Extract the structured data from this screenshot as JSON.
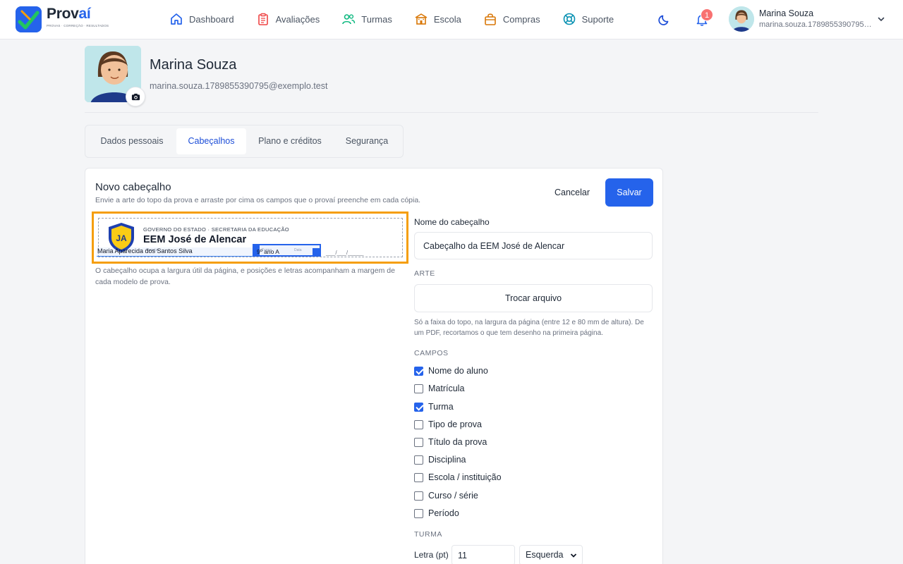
{
  "brand": {
    "name_main": "Prov",
    "name_accent": "aí",
    "tagline": "PROVAS · CORREÇÃO · RESULTADOS",
    "accent_color": "#2563eb"
  },
  "nav": [
    {
      "label": "Dashboard",
      "icon": "home-icon",
      "color": "#2563eb"
    },
    {
      "label": "Avaliações",
      "icon": "clipboard-icon",
      "color": "#ef4444"
    },
    {
      "label": "Turmas",
      "icon": "users-icon",
      "color": "#10b981"
    },
    {
      "label": "Escola",
      "icon": "school-icon",
      "color": "#d97706"
    },
    {
      "label": "Compras",
      "icon": "shopping-bag-icon",
      "color": "#d97706"
    },
    {
      "label": "Suporte",
      "icon": "lifebuoy-icon",
      "color": "#0891b2"
    }
  ],
  "notifications": {
    "count": "1"
  },
  "user": {
    "name": "Marina Souza",
    "email": "marina.souza.1789855390795@exemplo.test"
  },
  "profile": {
    "name": "Marina Souza",
    "email": "marina.souza.1789855390795@exemplo.test"
  },
  "tabs": [
    {
      "label": "Dados pessoais",
      "active": false
    },
    {
      "label": "Cabeçalhos",
      "active": true
    },
    {
      "label": "Plano e créditos",
      "active": false
    },
    {
      "label": "Segurança",
      "active": false
    }
  ],
  "editor": {
    "title": "Novo cabeçalho",
    "subtitle": "Envie a arte do topo da prova e arraste por cima os campos que o provaí preenche em cada cópia.",
    "cancel_label": "Cancelar",
    "save_label": "Salvar",
    "preview": {
      "shield_initials": "JA",
      "gov_line": "GOVERNO DO ESTADO · SECRETARIA DA EDUCAÇÃO",
      "school_name": "EEM José de Alencar",
      "student_label": "Aluno(a)",
      "class_label": "Turma",
      "date_label": "Data",
      "date_placeholder": "___/___/_____",
      "student_value": "Maria Aparecida dos Santos Silva",
      "class_value": "9º ano A"
    },
    "preview_note": "O cabeçalho ocupa a largura útil da página, e posições e letras acompanham a margem de cada modelo de prova.",
    "name_label": "Nome do cabeçalho",
    "name_value": "Cabeçalho da EEM José de Alencar",
    "art_section": "ARTE",
    "file_button": "Trocar arquivo",
    "file_note": "Só a faixa do topo, na largura da página (entre 12 e 80 mm de altura). De um PDF, recortamos o que tem desenho na primeira página.",
    "fields_section": "CAMPOS",
    "fields": [
      {
        "label": "Nome do aluno",
        "checked": true
      },
      {
        "label": "Matrícula",
        "checked": false
      },
      {
        "label": "Turma",
        "checked": true
      },
      {
        "label": "Tipo de prova",
        "checked": false
      },
      {
        "label": "Título da prova",
        "checked": false
      },
      {
        "label": "Disciplina",
        "checked": false
      },
      {
        "label": "Escola / instituição",
        "checked": false
      },
      {
        "label": "Curso / série",
        "checked": false
      },
      {
        "label": "Período",
        "checked": false
      }
    ],
    "class_section": "TURMA",
    "font_label": "Letra (pt)",
    "font_size": "11",
    "align_value": "Esquerda"
  }
}
